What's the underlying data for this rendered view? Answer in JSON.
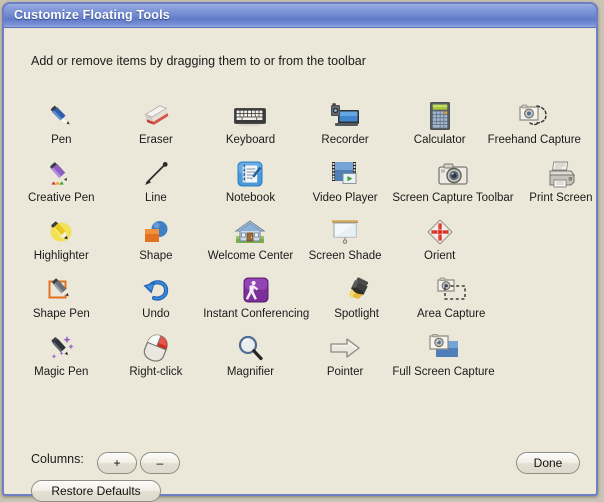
{
  "window": {
    "title": "Customize Floating Tools",
    "instruction": "Add or remove items by dragging them to or from the toolbar",
    "accent_color": "#6f88d0",
    "background_color": "#ebe7d9",
    "border_color": "#6f7fc4"
  },
  "grid": {
    "columns": 6,
    "rows": [
      [
        {
          "label": "Pen",
          "icon": "pen-icon"
        },
        {
          "label": "Eraser",
          "icon": "eraser-icon"
        },
        {
          "label": "Keyboard",
          "icon": "keyboard-icon"
        },
        {
          "label": "Recorder",
          "icon": "recorder-icon"
        },
        {
          "label": "Calculator",
          "icon": "calculator-icon"
        },
        {
          "label": "Freehand Capture",
          "icon": "freehand-capture-icon"
        }
      ],
      [
        {
          "label": "Creative Pen",
          "icon": "creative-pen-icon"
        },
        {
          "label": "Line",
          "icon": "line-icon"
        },
        {
          "label": "Notebook",
          "icon": "notebook-icon"
        },
        {
          "label": "Video Player",
          "icon": "video-player-icon"
        },
        {
          "label": "Screen Capture Toolbar",
          "icon": "screen-capture-toolbar-icon"
        },
        {
          "label": "Print Screen",
          "icon": "print-screen-icon"
        }
      ],
      [
        {
          "label": "Highlighter",
          "icon": "highlighter-icon"
        },
        {
          "label": "Shape",
          "icon": "shape-icon"
        },
        {
          "label": "Welcome Center",
          "icon": "welcome-center-icon"
        },
        {
          "label": "Screen Shade",
          "icon": "screen-shade-icon"
        },
        {
          "label": "Orient",
          "icon": "orient-icon"
        }
      ],
      [
        {
          "label": "Shape Pen",
          "icon": "shape-pen-icon"
        },
        {
          "label": "Undo",
          "icon": "undo-icon"
        },
        {
          "label": "Instant Conferencing",
          "icon": "instant-conferencing-icon"
        },
        {
          "label": "Spotlight",
          "icon": "spotlight-icon"
        },
        {
          "label": "Area Capture",
          "icon": "area-capture-icon"
        }
      ],
      [
        {
          "label": "Magic Pen",
          "icon": "magic-pen-icon"
        },
        {
          "label": "Right-click",
          "icon": "right-click-icon"
        },
        {
          "label": "Magnifier",
          "icon": "magnifier-icon"
        },
        {
          "label": "Pointer",
          "icon": "pointer-icon"
        },
        {
          "label": "Full Screen Capture",
          "icon": "full-screen-capture-icon"
        }
      ]
    ]
  },
  "controls": {
    "columns_label": "Columns:",
    "plus_label": "+",
    "minus_label": "–",
    "restore_label": "Restore Defaults",
    "done_label": "Done"
  }
}
